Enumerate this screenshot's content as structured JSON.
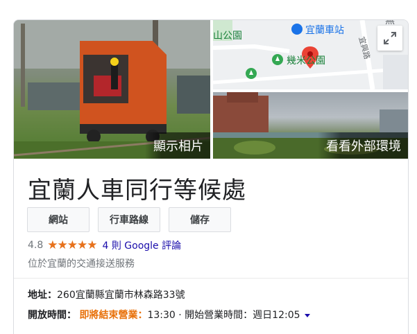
{
  "photos": {
    "main_label": "顯示相片",
    "exterior_label": "看看外部環境"
  },
  "map": {
    "station_label": "宜蘭車站",
    "park_partial_label": "山公園",
    "park_label": "幾米公園",
    "road_label": "宜興路",
    "corner_label": "無"
  },
  "place": {
    "name": "宜蘭人車同行等候處"
  },
  "actions": {
    "website": "網站",
    "directions": "行車路線",
    "save": "儲存"
  },
  "rating": {
    "score": "4.8",
    "stars": "★★★★★",
    "reviews_text": "4 則 Google 評論"
  },
  "description": "位於宜蘭的交通接送服務",
  "address": {
    "label": "地址：",
    "value": "260宜蘭縣宜蘭市林森路33號"
  },
  "hours": {
    "label": "開放時間：",
    "status": "即將結束營業：",
    "close_time": "13:30",
    "separator": "·",
    "next_open": "開始營業時間：週日12:05"
  },
  "colors": {
    "star": "#e7711b",
    "closing": "#e8710a",
    "link": "#1a0dab",
    "map_pin": "#ea4335"
  }
}
